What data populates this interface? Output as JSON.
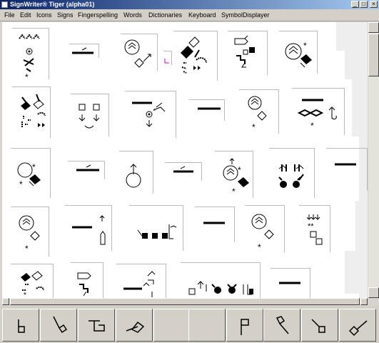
{
  "window": {
    "title": "SignWriter® Tiger (alpha01)",
    "title_bar_color": "#0a246a"
  },
  "menu": [
    "File",
    "Edit",
    "Icons",
    "Signs",
    "Fingerspelling",
    "Words",
    "Dictionaries",
    "Keyboard",
    "SymbolDisplayer"
  ],
  "sign_rows": [
    [
      "sign-1-1",
      "sign-1-2",
      "sign-1-3",
      "sign-1-4",
      "sign-1-5",
      "sign-1-6"
    ],
    [
      "sign-2-1",
      "sign-2-2",
      "sign-2-3",
      "sign-2-4",
      "sign-2-5",
      "sign-2-6",
      "sign-2-7"
    ],
    [
      "sign-3-1",
      "sign-3-2",
      "sign-3-3",
      "sign-3-4",
      "sign-3-5",
      "sign-3-6",
      "sign-3-7"
    ],
    [
      "sign-4-1",
      "sign-4-2",
      "sign-4-3",
      "sign-4-4",
      "sign-4-5",
      "sign-4-6"
    ],
    [
      "sign-5-1",
      "sign-5-2",
      "sign-5-3",
      "sign-5-4",
      "sign-5-5"
    ]
  ],
  "palette": {
    "buttons": [
      "handshape-square-down-icon",
      "handshape-diamond-down-icon",
      "handshape-square-side-icon",
      "handshape-diamond-side-icon",
      "empty-slot",
      "empty-slot",
      "handshape-flag-up-icon",
      "handshape-diamond-tail-icon",
      "handshape-square-angle-icon",
      "handshape-check-icon"
    ]
  }
}
